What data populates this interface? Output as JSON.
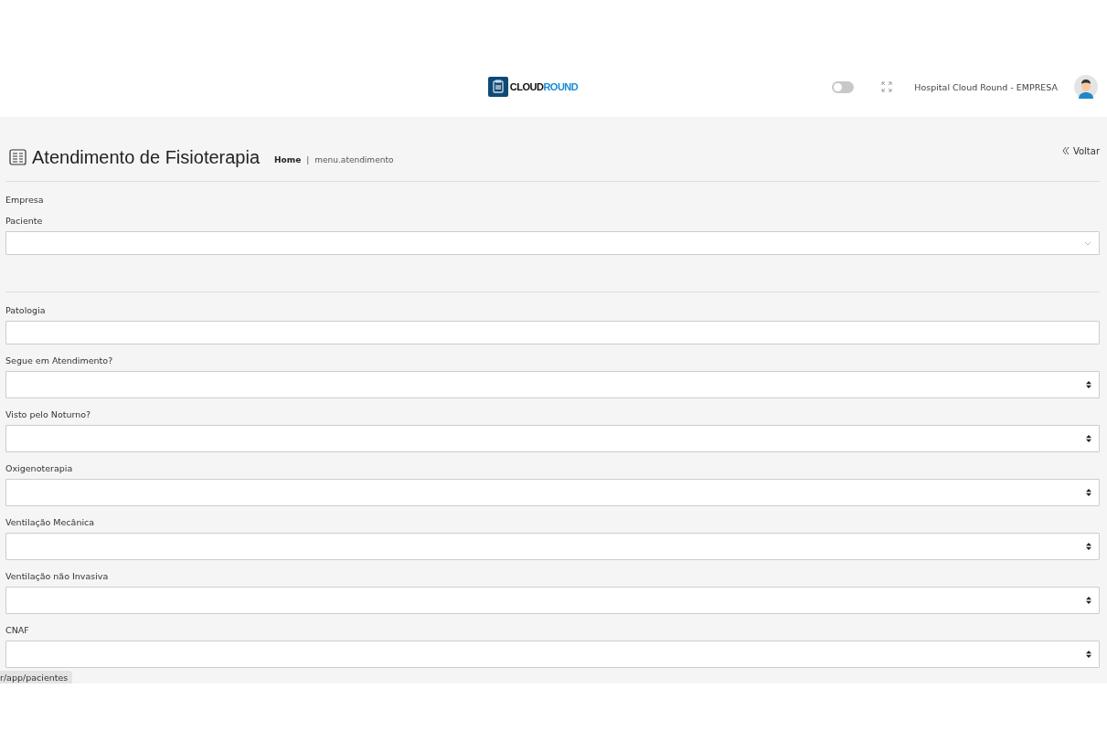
{
  "header": {
    "logo": {
      "part1": "CLOUD",
      "part2": "ROUND"
    },
    "theme_toggle": {
      "on": false
    },
    "company": "Hospital Cloud Round - EMPRESA"
  },
  "page": {
    "title": "Atendimento de Fisioterapia",
    "breadcrumb": [
      "Home",
      "menu.atendimento"
    ],
    "breadcrumb_separator": "|",
    "back": "Voltar"
  },
  "top_fields": [
    {
      "label": "Empresa",
      "kind": "label"
    },
    {
      "label": "Paciente",
      "kind": "combo"
    }
  ],
  "fields": [
    {
      "label": "Patologia",
      "kind": "text"
    },
    {
      "label": "Segue em Atendimento?",
      "kind": "select"
    },
    {
      "label": "Visto pelo Noturno?",
      "kind": "select"
    },
    {
      "label": "Oxigenoterapia",
      "kind": "select"
    },
    {
      "label": "Ventilação Mecânica",
      "kind": "select"
    },
    {
      "label": "Ventilação não Invasiva",
      "kind": "select"
    },
    {
      "label": "CNAF",
      "kind": "select"
    }
  ],
  "status_bar": {
    "url": "r/app/pacientes"
  }
}
